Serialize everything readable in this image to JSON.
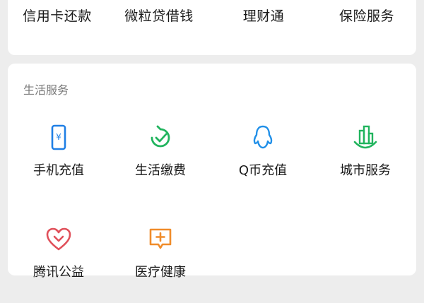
{
  "top_services": [
    {
      "label": "信用卡还款"
    },
    {
      "label": "微粒贷借钱"
    },
    {
      "label": "理财通"
    },
    {
      "label": "保险服务"
    }
  ],
  "life_services": {
    "title": "生活服务",
    "items": [
      {
        "label": "手机充值",
        "icon": "phone-recharge-icon",
        "color": "#1f7fe5"
      },
      {
        "label": "生活缴费",
        "icon": "utility-payment-icon",
        "color": "#21b45e"
      },
      {
        "label": "Q币充值",
        "icon": "qq-penguin-icon",
        "color": "#1f8fe8"
      },
      {
        "label": "城市服务",
        "icon": "city-buildings-icon",
        "color": "#21b45e"
      },
      {
        "label": "腾讯公益",
        "icon": "charity-heart-icon",
        "color": "#e0505a"
      },
      {
        "label": "医疗健康",
        "icon": "medical-plus-icon",
        "color": "#f08c2a"
      }
    ]
  }
}
